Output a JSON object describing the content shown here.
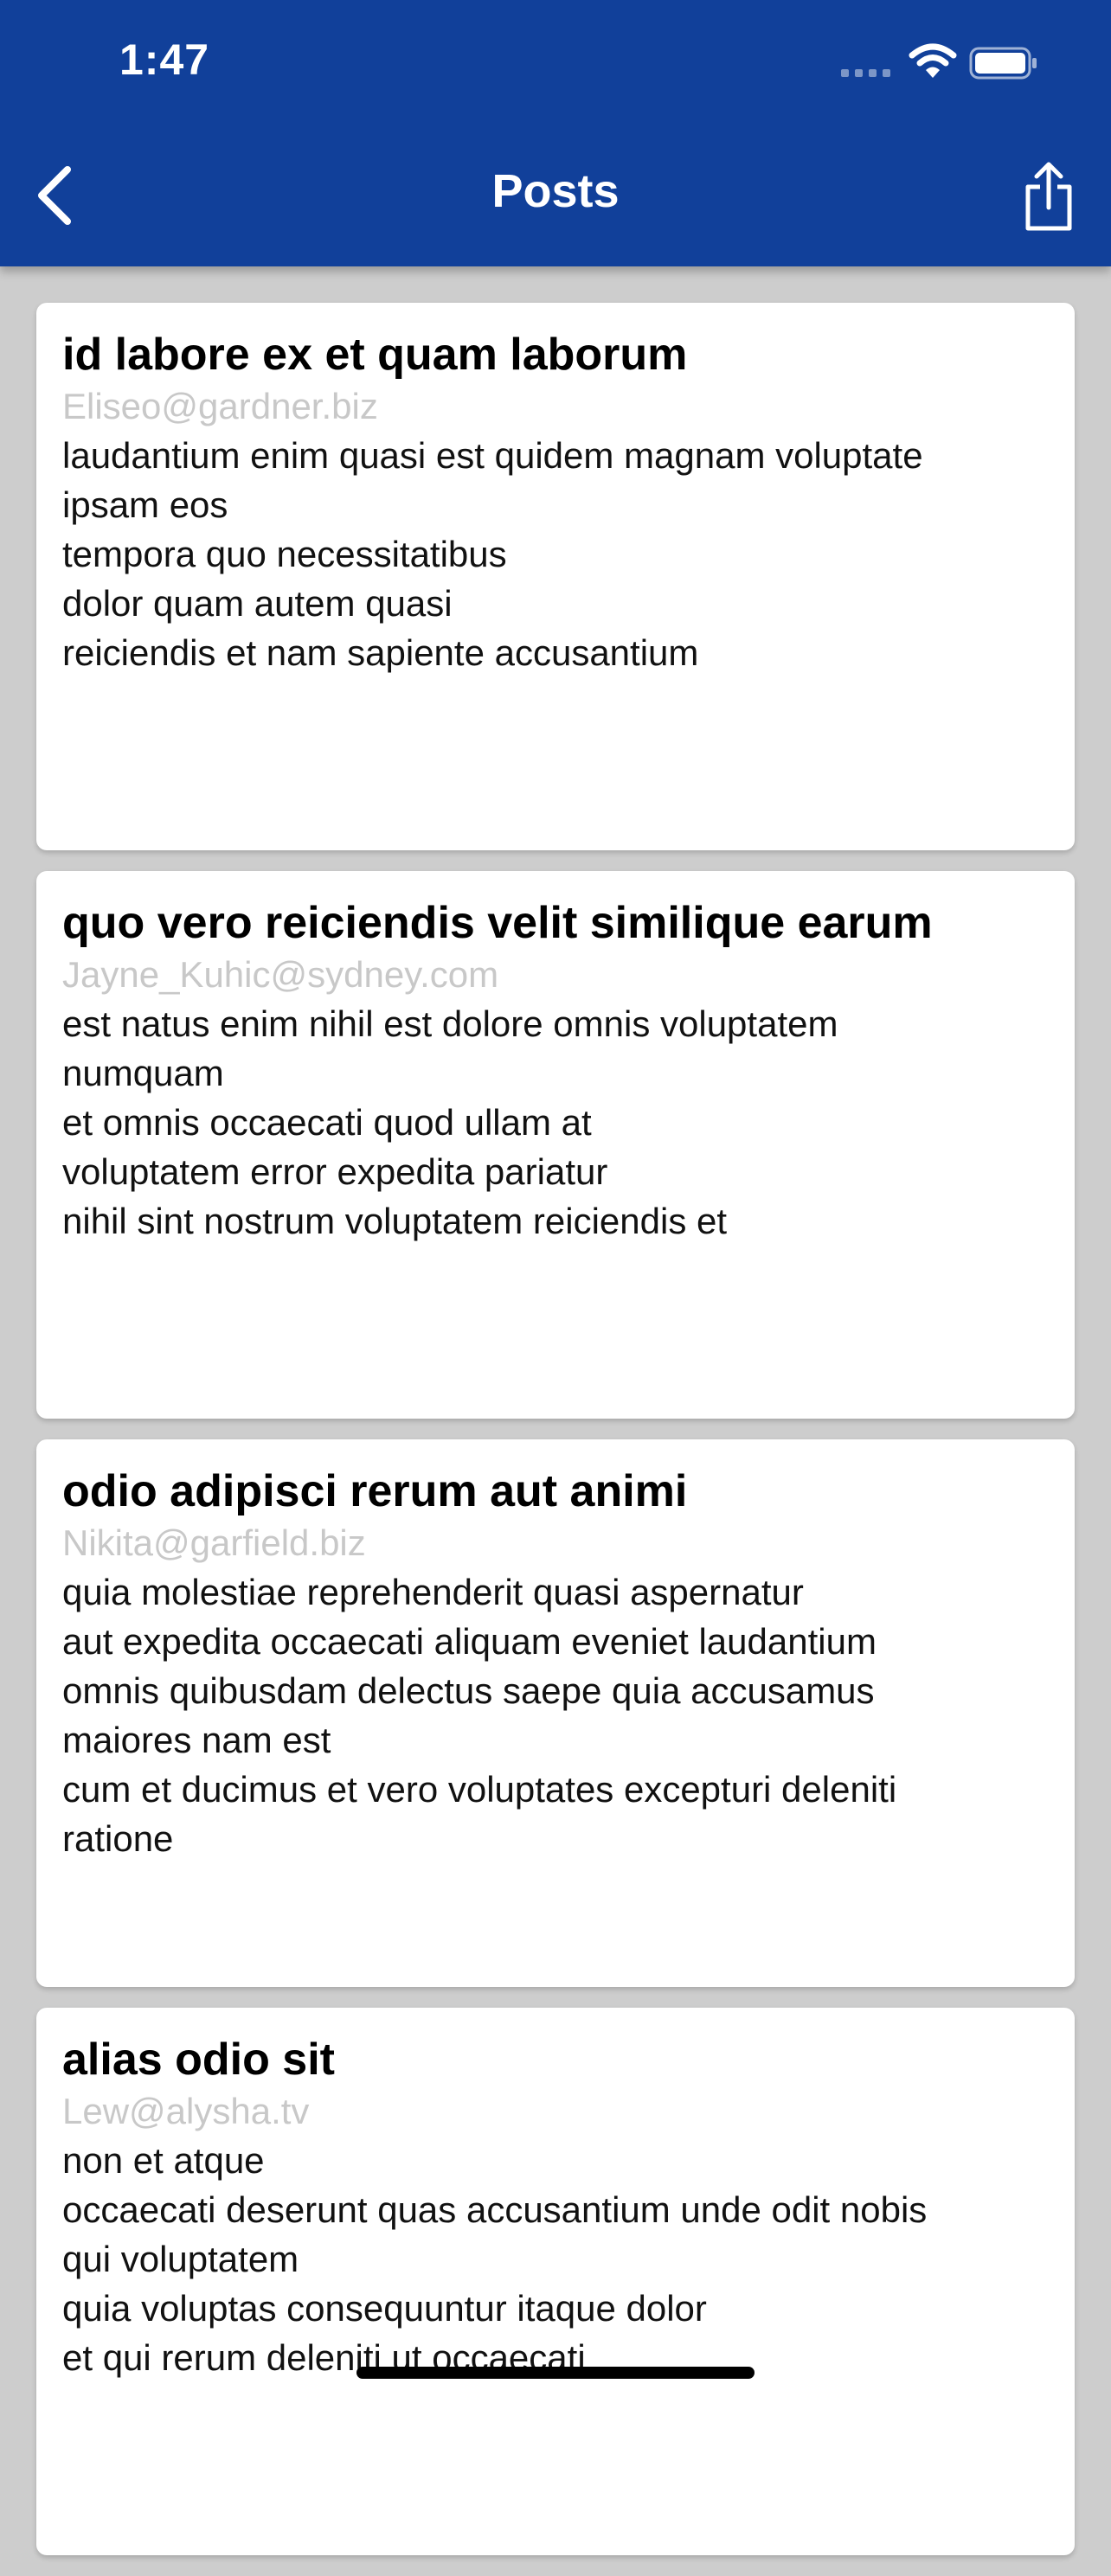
{
  "status_bar": {
    "time": "1:47",
    "icons": [
      "signal-icon",
      "wifi-icon",
      "battery-icon"
    ]
  },
  "nav": {
    "title": "Posts",
    "back_icon": "chevron-left-icon",
    "share_icon": "share-icon"
  },
  "colors": {
    "nav_background": "#11409a",
    "page_background": "#cdcdcd",
    "card_background": "#ffffff",
    "email_text": "#c8c8c8"
  },
  "posts": [
    {
      "title": "id labore ex et quam laborum",
      "email": "Eliseo@gardner.biz",
      "body": "laudantium enim quasi est quidem magnam voluptate\nipsam eos\ntempora quo necessitatibus\ndolor quam autem quasi\nreiciendis et nam sapiente accusantium"
    },
    {
      "title": "quo vero reiciendis velit similique earum",
      "email": "Jayne_Kuhic@sydney.com",
      "body": "est natus enim nihil est dolore omnis voluptatem\nnumquam\net omnis occaecati quod ullam at\nvoluptatem error expedita pariatur\nnihil sint nostrum voluptatem reiciendis et"
    },
    {
      "title": "odio adipisci rerum aut animi",
      "email": "Nikita@garfield.biz",
      "body": "quia molestiae reprehenderit quasi aspernatur\naut expedita occaecati aliquam eveniet laudantium\nomnis quibusdam delectus saepe quia accusamus\nmaiores nam est\ncum et ducimus et vero voluptates excepturi deleniti\nratione"
    },
    {
      "title": "alias odio sit",
      "email": "Lew@alysha.tv",
      "body": "non et atque\noccaecati deserunt quas accusantium unde odit nobis\nqui voluptatem\nquia voluptas consequuntur itaque dolor\net qui rerum deleniti ut occaecati"
    }
  ]
}
